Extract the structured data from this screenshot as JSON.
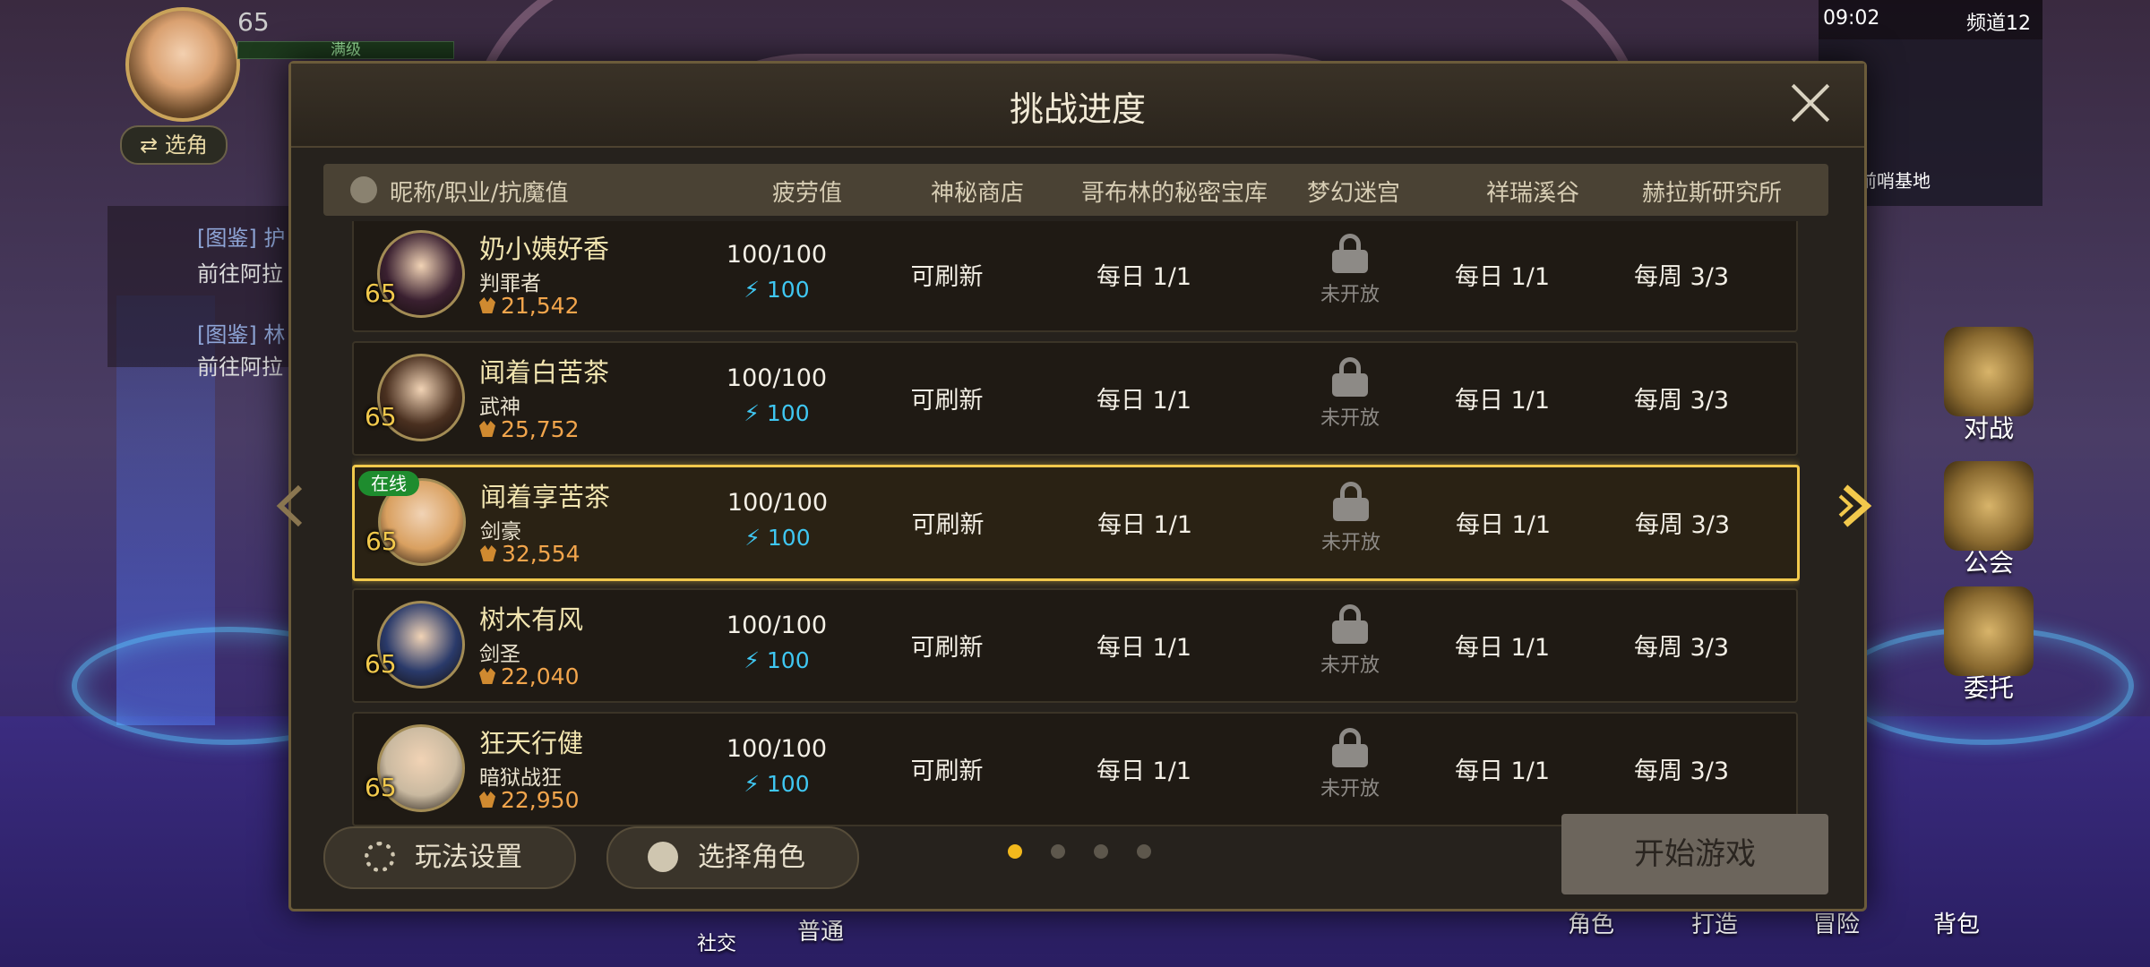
{
  "hud": {
    "level": "65",
    "exp_label": "满级",
    "switch_char": "⇄ 选角"
  },
  "quests": [
    {
      "tag": "[图鉴] 护",
      "desc": "前往阿拉"
    },
    {
      "tag": "[图鉴] 林",
      "desc": "前往阿拉"
    }
  ],
  "status": {
    "time": "09:02",
    "channel": "频道12",
    "location": "拉尔前哨基地"
  },
  "side_menu": [
    {
      "label": "对战",
      "icon": "swords-icon"
    },
    {
      "label": "公会",
      "icon": "guild-icon"
    },
    {
      "label": "委托",
      "icon": "commission-board-icon"
    }
  ],
  "bottom_bar": {
    "social": "社交",
    "normal": "普通",
    "character": "角色",
    "craft": "打造",
    "adventure": "冒险",
    "bag": "背包"
  },
  "dialog": {
    "title": "挑战进度",
    "columns": [
      "昵称/职业/抗魔值",
      "疲劳值",
      "神秘商店",
      "哥布林的秘密宝库",
      "梦幻迷宫",
      "祥瑞溪谷",
      "赫拉斯研究所"
    ],
    "online_label": "在线",
    "locked_label": "未开放",
    "rows": [
      {
        "name": "奶小姨好香",
        "class": "判罪者",
        "power": "21,542",
        "level": "65",
        "fatigue": "100/100",
        "energy": "100",
        "shop": "可刷新",
        "goblin": "每日 1/1",
        "daily2": "每日 1/1",
        "weekly": "每周 3/3",
        "online": false,
        "selected": false,
        "avatar_color": "#3a2030"
      },
      {
        "name": "闻着白苦茶",
        "class": "武神",
        "power": "25,752",
        "level": "65",
        "fatigue": "100/100",
        "energy": "100",
        "shop": "可刷新",
        "goblin": "每日 1/1",
        "daily2": "每日 1/1",
        "weekly": "每周 3/3",
        "online": false,
        "selected": false,
        "avatar_color": "#4a3020"
      },
      {
        "name": "闻着享苦茶",
        "class": "剑豪",
        "power": "32,554",
        "level": "65",
        "fatigue": "100/100",
        "energy": "100",
        "shop": "可刷新",
        "goblin": "每日 1/1",
        "daily2": "每日 1/1",
        "weekly": "每周 3/3",
        "online": true,
        "selected": true,
        "avatar_color": "#d9a060"
      },
      {
        "name": "树木有风",
        "class": "剑圣",
        "power": "22,040",
        "level": "65",
        "fatigue": "100/100",
        "energy": "100",
        "shop": "可刷新",
        "goblin": "每日 1/1",
        "daily2": "每日 1/1",
        "weekly": "每周 3/3",
        "online": false,
        "selected": false,
        "avatar_color": "#2a3a6a"
      },
      {
        "name": "狂天行健",
        "class": "暗狱战狂",
        "power": "22,950",
        "level": "65",
        "fatigue": "100/100",
        "energy": "100",
        "shop": "可刷新",
        "goblin": "每日 1/1",
        "daily2": "每日 1/1",
        "weekly": "每周 3/3",
        "online": false,
        "selected": false,
        "avatar_color": "#c9b9a0"
      }
    ],
    "footer": {
      "settings_label": "玩法设置",
      "select_char_label": "选择角色",
      "start_label": "开始游戏",
      "page_count": 4,
      "active_page": 1
    }
  }
}
